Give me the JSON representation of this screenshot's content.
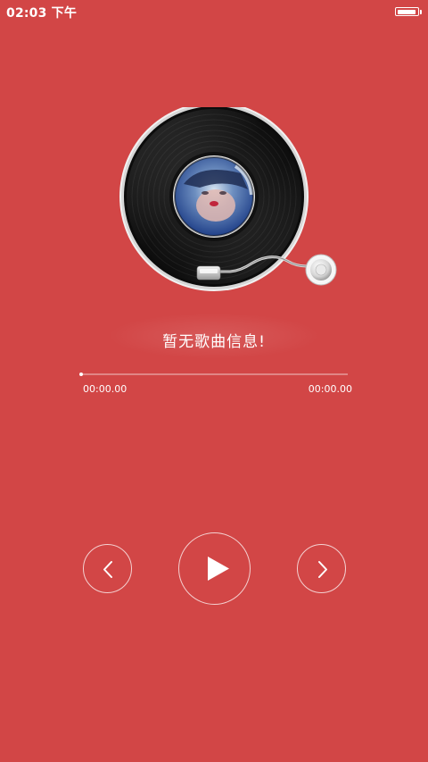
{
  "status_bar": {
    "time": "02:03 下午",
    "battery_level": 0.95
  },
  "player": {
    "song_info": "暂无歌曲信息!",
    "progress": 0,
    "current_time": "00:00.00",
    "total_time": "00:00.00"
  },
  "controls": {
    "prev_icon": "chevron-left-icon",
    "play_icon": "play-icon",
    "next_icon": "chevron-right-icon"
  },
  "theme": {
    "background": "#d24646",
    "foreground": "#ffffff"
  }
}
